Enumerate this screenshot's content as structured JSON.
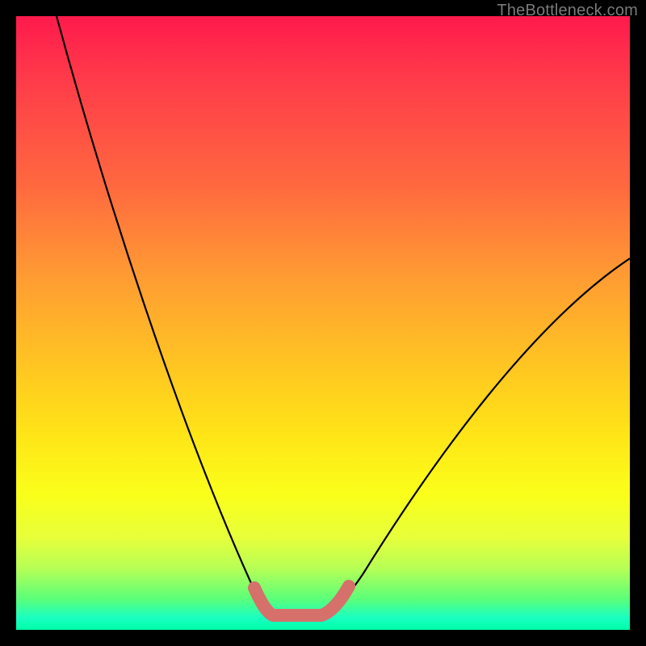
{
  "watermark": "TheBottleneck.com",
  "colors": {
    "curve_stroke": "#000000",
    "highlight_stroke": "#d6706b",
    "background_black": "#000000"
  },
  "chart_data": {
    "type": "line",
    "title": "",
    "xlabel": "",
    "ylabel": "",
    "xlim": [
      0,
      100
    ],
    "ylim": [
      0,
      100
    ],
    "series": [
      {
        "name": "bottleneck-curve",
        "x": [
          0,
          3,
          6,
          9,
          12,
          15,
          18,
          21,
          24,
          27,
          30,
          33,
          36,
          39,
          41,
          43,
          45,
          47,
          49,
          51,
          55,
          60,
          65,
          70,
          75,
          80,
          85,
          90,
          95,
          100
        ],
        "values": [
          100,
          92,
          84,
          76,
          68,
          60,
          52,
          44,
          36,
          28,
          21,
          15,
          10,
          6,
          3,
          1,
          0,
          0,
          0,
          1,
          5,
          12,
          20,
          28,
          35,
          42,
          48,
          53,
          57,
          60
        ]
      },
      {
        "name": "optimal-range-highlight",
        "x": [
          40,
          42,
          44,
          46,
          48,
          50,
          52
        ],
        "values": [
          4,
          2,
          1,
          0,
          0,
          1,
          3
        ]
      }
    ],
    "annotations": []
  }
}
